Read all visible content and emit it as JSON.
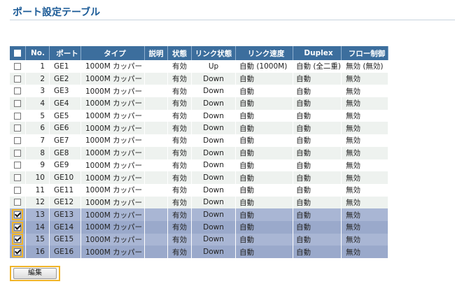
{
  "page": {
    "title": "ポート設定テーブル"
  },
  "table": {
    "headers": [
      "No.",
      "ポート",
      "タイプ",
      "説明",
      "状態",
      "リンク状態",
      "リンク速度",
      "Duplex",
      "フロー制御"
    ],
    "rows": [
      {
        "no": "1",
        "port": "GE1",
        "type": "1000M カッパー",
        "desc": "",
        "state": "有効",
        "link": "Up",
        "speed": "自動 (1000M)",
        "duplex": "自動 (全二重)",
        "flow": "無効 (無効)",
        "checked": false
      },
      {
        "no": "2",
        "port": "GE2",
        "type": "1000M カッパー",
        "desc": "",
        "state": "有効",
        "link": "Down",
        "speed": "自動",
        "duplex": "自動",
        "flow": "無効",
        "checked": false
      },
      {
        "no": "3",
        "port": "GE3",
        "type": "1000M カッパー",
        "desc": "",
        "state": "有効",
        "link": "Down",
        "speed": "自動",
        "duplex": "自動",
        "flow": "無効",
        "checked": false
      },
      {
        "no": "4",
        "port": "GE4",
        "type": "1000M カッパー",
        "desc": "",
        "state": "有効",
        "link": "Down",
        "speed": "自動",
        "duplex": "自動",
        "flow": "無効",
        "checked": false
      },
      {
        "no": "5",
        "port": "GE5",
        "type": "1000M カッパー",
        "desc": "",
        "state": "有効",
        "link": "Down",
        "speed": "自動",
        "duplex": "自動",
        "flow": "無効",
        "checked": false
      },
      {
        "no": "6",
        "port": "GE6",
        "type": "1000M カッパー",
        "desc": "",
        "state": "有効",
        "link": "Down",
        "speed": "自動",
        "duplex": "自動",
        "flow": "無効",
        "checked": false
      },
      {
        "no": "7",
        "port": "GE7",
        "type": "1000M カッパー",
        "desc": "",
        "state": "有効",
        "link": "Down",
        "speed": "自動",
        "duplex": "自動",
        "flow": "無効",
        "checked": false
      },
      {
        "no": "8",
        "port": "GE8",
        "type": "1000M カッパー",
        "desc": "",
        "state": "有効",
        "link": "Down",
        "speed": "自動",
        "duplex": "自動",
        "flow": "無効",
        "checked": false
      },
      {
        "no": "9",
        "port": "GE9",
        "type": "1000M カッパー",
        "desc": "",
        "state": "有効",
        "link": "Down",
        "speed": "自動",
        "duplex": "自動",
        "flow": "無効",
        "checked": false
      },
      {
        "no": "10",
        "port": "GE10",
        "type": "1000M カッパー",
        "desc": "",
        "state": "有効",
        "link": "Down",
        "speed": "自動",
        "duplex": "自動",
        "flow": "無効",
        "checked": false
      },
      {
        "no": "11",
        "port": "GE11",
        "type": "1000M カッパー",
        "desc": "",
        "state": "有効",
        "link": "Down",
        "speed": "自動",
        "duplex": "自動",
        "flow": "無効",
        "checked": false
      },
      {
        "no": "12",
        "port": "GE12",
        "type": "1000M カッパー",
        "desc": "",
        "state": "有効",
        "link": "Down",
        "speed": "自動",
        "duplex": "自動",
        "flow": "無効",
        "checked": false
      },
      {
        "no": "13",
        "port": "GE13",
        "type": "1000M カッパー",
        "desc": "",
        "state": "有効",
        "link": "Down",
        "speed": "自動",
        "duplex": "自動",
        "flow": "無効",
        "checked": true
      },
      {
        "no": "14",
        "port": "GE14",
        "type": "1000M カッパー",
        "desc": "",
        "state": "有効",
        "link": "Down",
        "speed": "自動",
        "duplex": "自動",
        "flow": "無効",
        "checked": true
      },
      {
        "no": "15",
        "port": "GE15",
        "type": "1000M カッパー",
        "desc": "",
        "state": "有効",
        "link": "Down",
        "speed": "自動",
        "duplex": "自動",
        "flow": "無効",
        "checked": true
      },
      {
        "no": "16",
        "port": "GE16",
        "type": "1000M カッパー",
        "desc": "",
        "state": "有効",
        "link": "Down",
        "speed": "自動",
        "duplex": "自動",
        "flow": "無効",
        "checked": true
      }
    ]
  },
  "buttons": {
    "edit": "編集"
  },
  "colors": {
    "header_bg": "#3c6e9d",
    "title": "#1a5a96",
    "selected_row": "#a9b6d4",
    "highlight": "#f0b429"
  }
}
